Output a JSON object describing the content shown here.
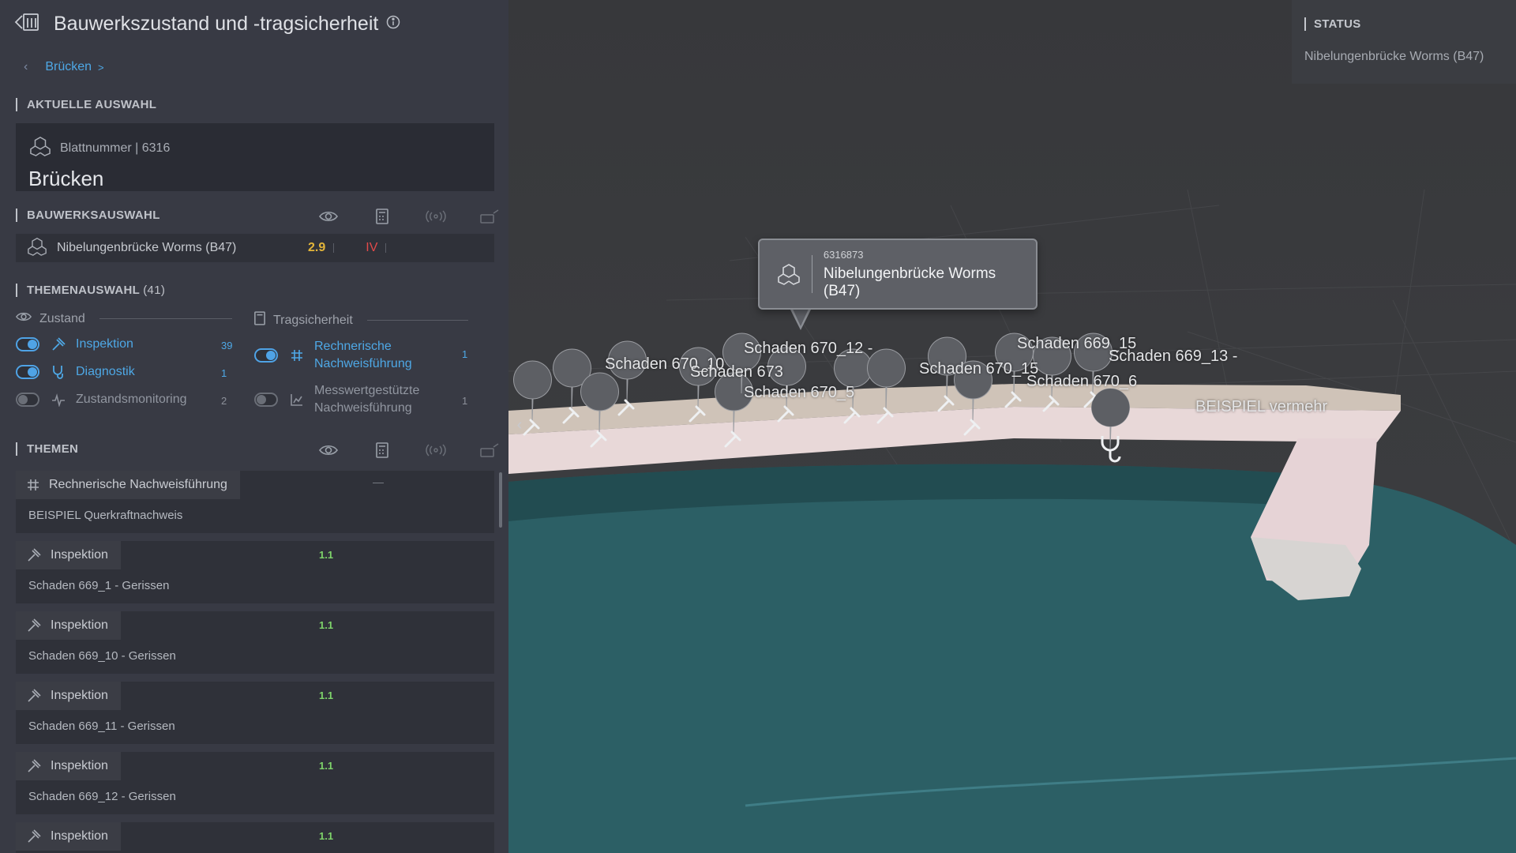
{
  "header": {
    "title": "Bauwerkszustand und -tragsicherheit"
  },
  "breadcrumb": {
    "item": "Brücken",
    "separator": ">"
  },
  "current_selection": {
    "heading": "AKTUELLE AUSWAHL",
    "sheet_label": "Blattnummer | 6316",
    "name": "Brücken"
  },
  "structure_selection": {
    "heading": "BAUWERKSAUSWAHL",
    "bridge_name": "Nibelungenbrücke Worms (B47)",
    "condition_value": "2.9",
    "safety_value": "IV"
  },
  "topic_selection": {
    "heading": "THEMENAUSWAHL",
    "count": "(41)",
    "column_condition": "Zustand",
    "column_safety": "Tragsicherheit",
    "left_items": [
      {
        "label": "Inspektion",
        "count": "39",
        "enabled": true
      },
      {
        "label": "Diagnostik",
        "count": "1",
        "enabled": true
      },
      {
        "label": "Zustandsmonitoring",
        "count": "2",
        "enabled": false
      }
    ],
    "right_items": [
      {
        "label_line1": "Rechnerische",
        "label_line2": "Nachweisführung",
        "count": "1",
        "enabled": true
      },
      {
        "label_line1": "Messwertgestützte",
        "label_line2": "Nachweisführung",
        "count": "1",
        "enabled": false
      }
    ]
  },
  "themes": {
    "heading": "THEMEN",
    "cards": [
      {
        "tag": "Rechnerische Nachweisführung",
        "description": "BEISPIEL Querkraftnachweis",
        "value": "",
        "marker": "—"
      },
      {
        "tag": "Inspektion",
        "description": "Schaden 669_1 - Gerissen",
        "value": "1.1"
      },
      {
        "tag": "Inspektion",
        "description": "Schaden 669_10 - Gerissen",
        "value": "1.1"
      },
      {
        "tag": "Inspektion",
        "description": "Schaden 669_11 - Gerissen",
        "value": "1.1"
      },
      {
        "tag": "Inspektion",
        "description": "Schaden 669_12 - Gerissen",
        "value": "1.1"
      },
      {
        "tag": "Inspektion",
        "description": "",
        "value": "1.1"
      }
    ]
  },
  "status": {
    "heading": "STATUS",
    "value": "Nibelungenbrücke Worms (B47)"
  },
  "popup": {
    "id": "6316873",
    "name": "Nibelungenbrücke Worms (B47)"
  },
  "scene_labels": [
    "Schaden 670_12 -",
    "Schaden 669_15",
    "Schaden 669_13 -",
    "Schaden 670_5",
    "Schaden 670_6",
    "Schaden 670_10",
    "Schaden 673",
    "Schaden 670_15",
    "BEISPIEL vermehr"
  ],
  "colors": {
    "accent": "#4ea8e6",
    "good_value": "#7ed36a",
    "warning_value": "#e3b53a",
    "critical_value": "#e24a4a",
    "water": "#2c5f65",
    "deck": "#e8d8d8"
  }
}
